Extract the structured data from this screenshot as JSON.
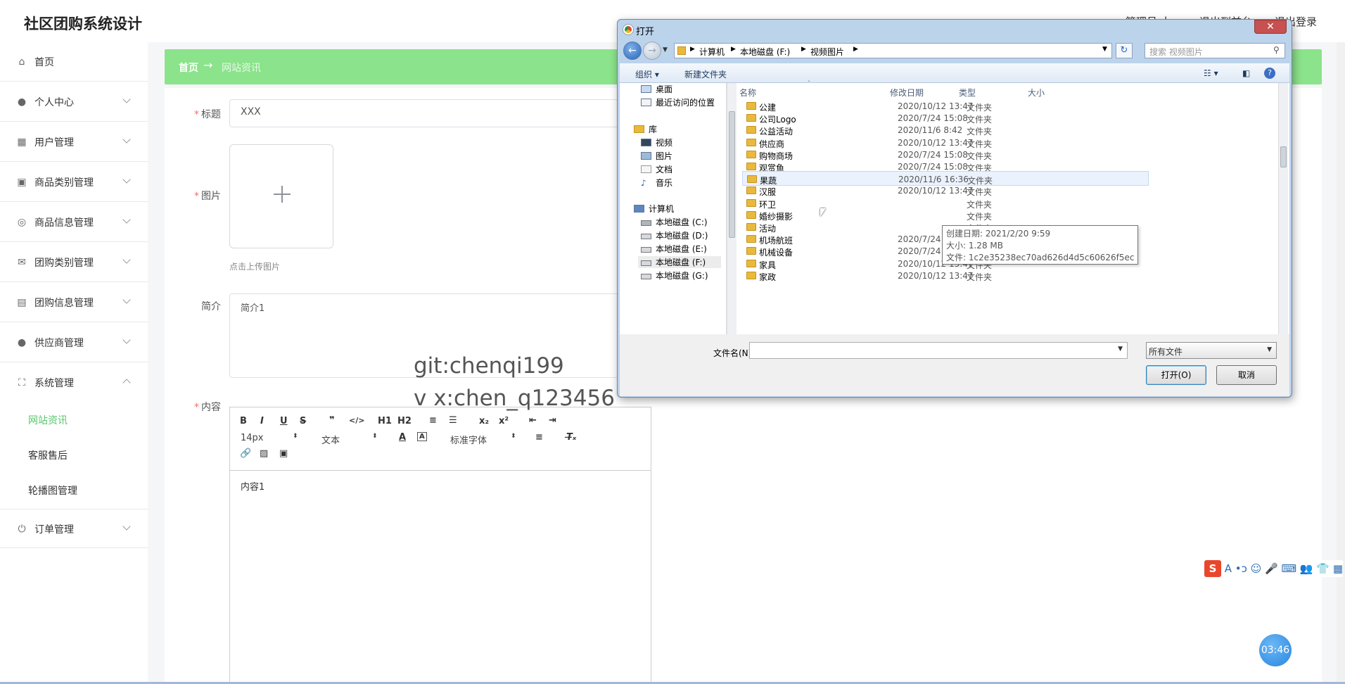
{
  "app": {
    "title": "社区团购系统设计",
    "user_text_1": "管理员 人",
    "user_text_2": "退出到前台",
    "user_text_3": "退出登录"
  },
  "sidebar": {
    "items": [
      {
        "label": "首页",
        "icon": "home-icon"
      },
      {
        "label": "个人中心",
        "icon": "user-icon"
      },
      {
        "label": "用户管理",
        "icon": "chart-icon"
      },
      {
        "label": "商品类别管理",
        "icon": "briefcase-icon"
      },
      {
        "label": "商品信息管理",
        "icon": "target-icon"
      },
      {
        "label": "团购类别管理",
        "icon": "mail-icon"
      },
      {
        "label": "团购信息管理",
        "icon": "clipboard-icon"
      },
      {
        "label": "供应商管理",
        "icon": "user-icon"
      },
      {
        "label": "系统管理",
        "icon": "expand-icon"
      },
      {
        "label": "订单管理",
        "icon": "power-icon"
      }
    ],
    "sub_items": [
      "网站资讯",
      "客服售后",
      "轮播图管理"
    ]
  },
  "breadcrumb": {
    "home": "首页",
    "arrow": "→",
    "current": "网站资讯"
  },
  "form": {
    "title_label": "标题",
    "title_value": "XXX",
    "image_label": "图片",
    "upload_hint": "点击上传图片",
    "intro_label": "简介",
    "intro_value": "简介1",
    "content_label": "内容",
    "content_value": "内容1"
  },
  "editor": {
    "font_size": "14px",
    "text_style": "文本",
    "font_family": "标准字体",
    "buttons": [
      "B",
      "I",
      "U",
      "S",
      "❞",
      "</>",
      "H1",
      "H2",
      "≡",
      "☰",
      "x₂",
      "x²",
      "⇤",
      "⇥"
    ]
  },
  "watermark": {
    "line1": "git:chenqi199",
    "line2": "v x:chen_q123456"
  },
  "dialog": {
    "title": "打开",
    "path": [
      "计算机",
      "本地磁盘 (F:)",
      "视频图片"
    ],
    "search_placeholder": "搜索 视频图片",
    "organize": "组织 ▾",
    "new_folder": "新建文件夹",
    "tree": [
      {
        "label": "桌面"
      },
      {
        "label": "最近访问的位置"
      },
      {
        "label": "库"
      },
      {
        "label": "视频"
      },
      {
        "label": "图片"
      },
      {
        "label": "文档"
      },
      {
        "label": "音乐"
      },
      {
        "label": "计算机"
      },
      {
        "label": "本地磁盘 (C:)"
      },
      {
        "label": "本地磁盘 (D:)"
      },
      {
        "label": "本地磁盘 (E:)"
      },
      {
        "label": "本地磁盘 (F:)"
      },
      {
        "label": "本地磁盘 (G:)"
      }
    ],
    "columns": {
      "name": "名称",
      "date": "修改日期",
      "type": "类型",
      "size": "大小"
    },
    "files": [
      {
        "name": "公建",
        "date": "2020/10/12 13:47",
        "type": "文件夹"
      },
      {
        "name": "公司Logo",
        "date": "2020/7/24 15:08",
        "type": "文件夹"
      },
      {
        "name": "公益活动",
        "date": "2020/11/6 8:42",
        "type": "文件夹"
      },
      {
        "name": "供应商",
        "date": "2020/10/12 13:47",
        "type": "文件夹"
      },
      {
        "name": "购物商场",
        "date": "2020/7/24 15:08",
        "type": "文件夹"
      },
      {
        "name": "观赏鱼",
        "date": "2020/7/24 15:08",
        "type": "文件夹"
      },
      {
        "name": "果蔬",
        "date": "2020/11/6 16:36",
        "type": "文件夹"
      },
      {
        "name": "汉服",
        "date": "2020/10/12 13:47",
        "type": "文件夹"
      },
      {
        "name": "环卫",
        "date": "",
        "type": "文件夹"
      },
      {
        "name": "婚纱摄影",
        "date": "",
        "type": "文件夹"
      },
      {
        "name": "活动",
        "date": "",
        "type": "文件夹"
      },
      {
        "name": "机场航班",
        "date": "2020/7/24 15:08",
        "type": "文件夹"
      },
      {
        "name": "机械设备",
        "date": "2020/7/24 15:08",
        "type": "文件夹"
      },
      {
        "name": "家具",
        "date": "2020/10/12 13:47",
        "type": "文件夹"
      },
      {
        "name": "家政",
        "date": "2020/10/12 13:47",
        "type": "文件夹"
      }
    ],
    "tooltip": {
      "created": "创建日期: 2021/2/20 9:59",
      "size": "大小: 1.28 MB",
      "files": "文件: 1c2e35238ec70ad626d4d5c60626f5ec, ..."
    },
    "filename_label": "文件名(N):",
    "filetype": "所有文件",
    "open_button": "打开(O)",
    "cancel_button": "取消"
  },
  "timer": "03:46"
}
